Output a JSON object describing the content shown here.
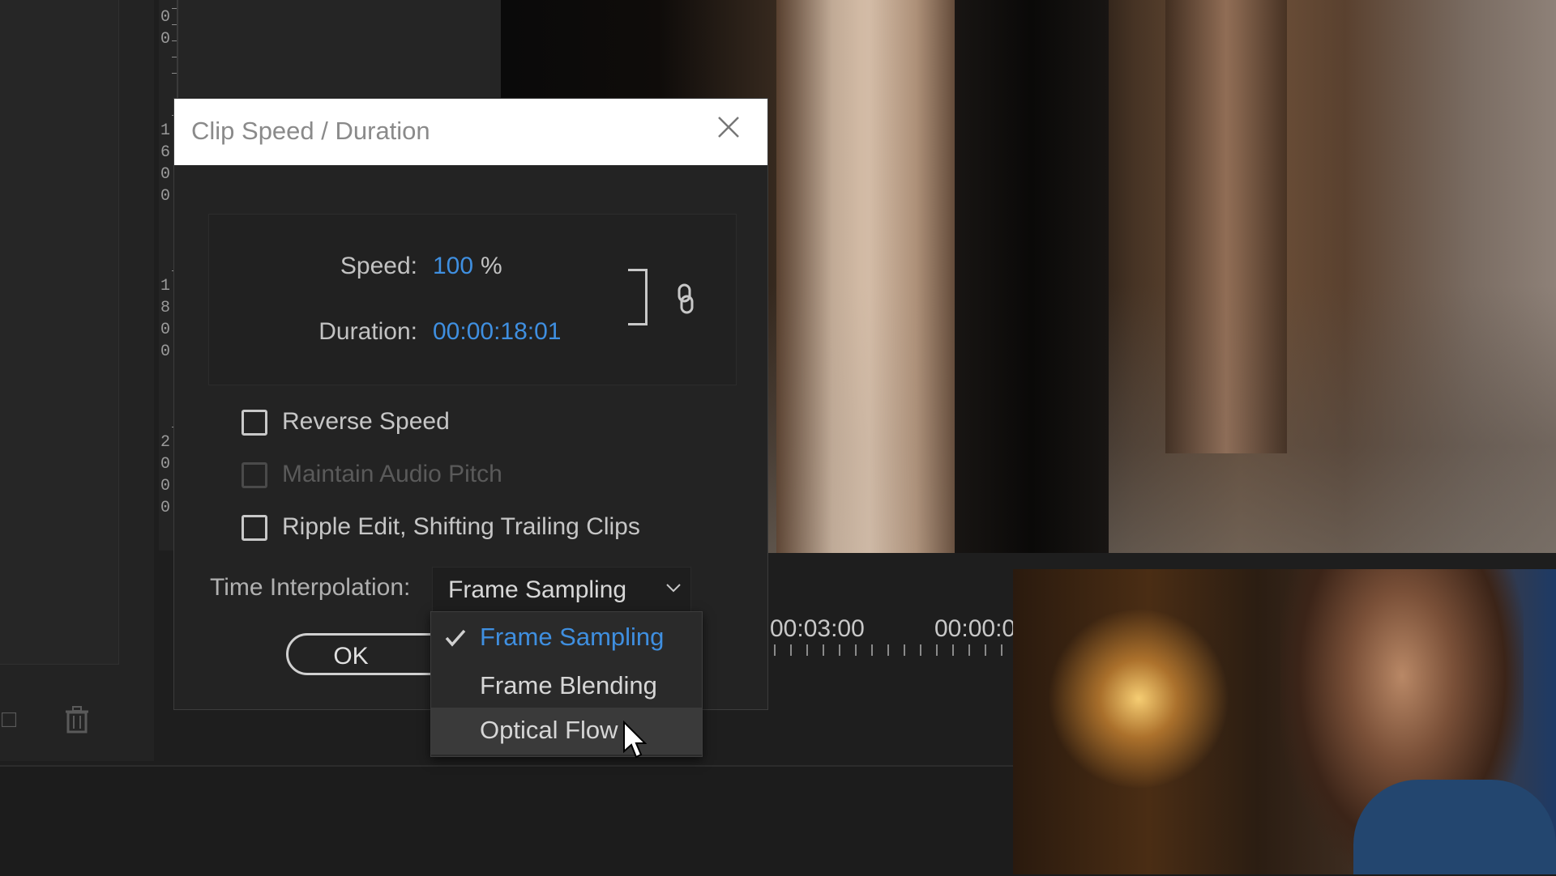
{
  "dialog": {
    "title": "Clip Speed / Duration",
    "speed_label": "Speed:",
    "speed_value": "100",
    "speed_unit": "%",
    "duration_label": "Duration:",
    "duration_value": "00:00:18:01",
    "checkboxes": [
      {
        "label": "Reverse Speed",
        "checked": false,
        "disabled": false
      },
      {
        "label": "Maintain Audio Pitch",
        "checked": false,
        "disabled": true
      },
      {
        "label": "Ripple Edit, Shifting Trailing Clips",
        "checked": false,
        "disabled": false
      }
    ],
    "interpolation_label": "Time Interpolation:",
    "interpolation_value": "Frame Sampling",
    "ok_label": "OK"
  },
  "menu": {
    "items": [
      {
        "label": "Frame Sampling",
        "selected": true
      },
      {
        "label": "Frame Blending",
        "selected": false
      },
      {
        "label": "Optical Flow",
        "selected": false,
        "hover": true
      }
    ]
  },
  "ruler": {
    "digits": [
      "0",
      "0",
      "1",
      "6",
      "0",
      "0",
      "1",
      "8",
      "0",
      "0",
      "2",
      "0",
      "0",
      "0"
    ]
  },
  "timeline": {
    "times": [
      "00:03:00",
      "00:00:0"
    ]
  },
  "colors": {
    "accent": "#3f8fe0"
  }
}
